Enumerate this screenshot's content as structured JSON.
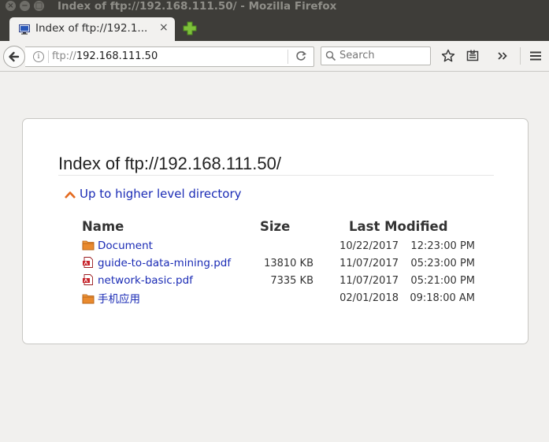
{
  "window": {
    "title": "Index of ftp://192.168.111.50/ - Mozilla Firefox"
  },
  "tab": {
    "label": "Index of ftp://192.1...",
    "close": "×"
  },
  "nav": {
    "url_scheme": "ftp://",
    "url_host": "192.168.111.50",
    "search_placeholder": "Search"
  },
  "page": {
    "title": "Index of ftp://192.168.111.50/",
    "up_link": "Up to higher level directory",
    "columns": {
      "name": "Name",
      "size": "Size",
      "modified": "Last Modified"
    },
    "rows": [
      {
        "type": "folder",
        "name": "Document",
        "size": "",
        "date": "10/22/2017",
        "time": "12:23:00 PM"
      },
      {
        "type": "pdf",
        "name": "guide-to-data-mining.pdf",
        "size": "13810 KB",
        "date": "11/07/2017",
        "time": "05:23:00 PM"
      },
      {
        "type": "pdf",
        "name": "network-basic.pdf",
        "size": "7335 KB",
        "date": "11/07/2017",
        "time": "05:21:00 PM"
      },
      {
        "type": "folder",
        "name": "手机应用",
        "size": "",
        "date": "02/01/2018",
        "time": "09:18:00 AM"
      }
    ]
  },
  "colors": {
    "link": "#1a2bb5",
    "chrome_dark": "#3e3d39",
    "folder": "#e98a2e",
    "pdf": "#c8242b"
  }
}
